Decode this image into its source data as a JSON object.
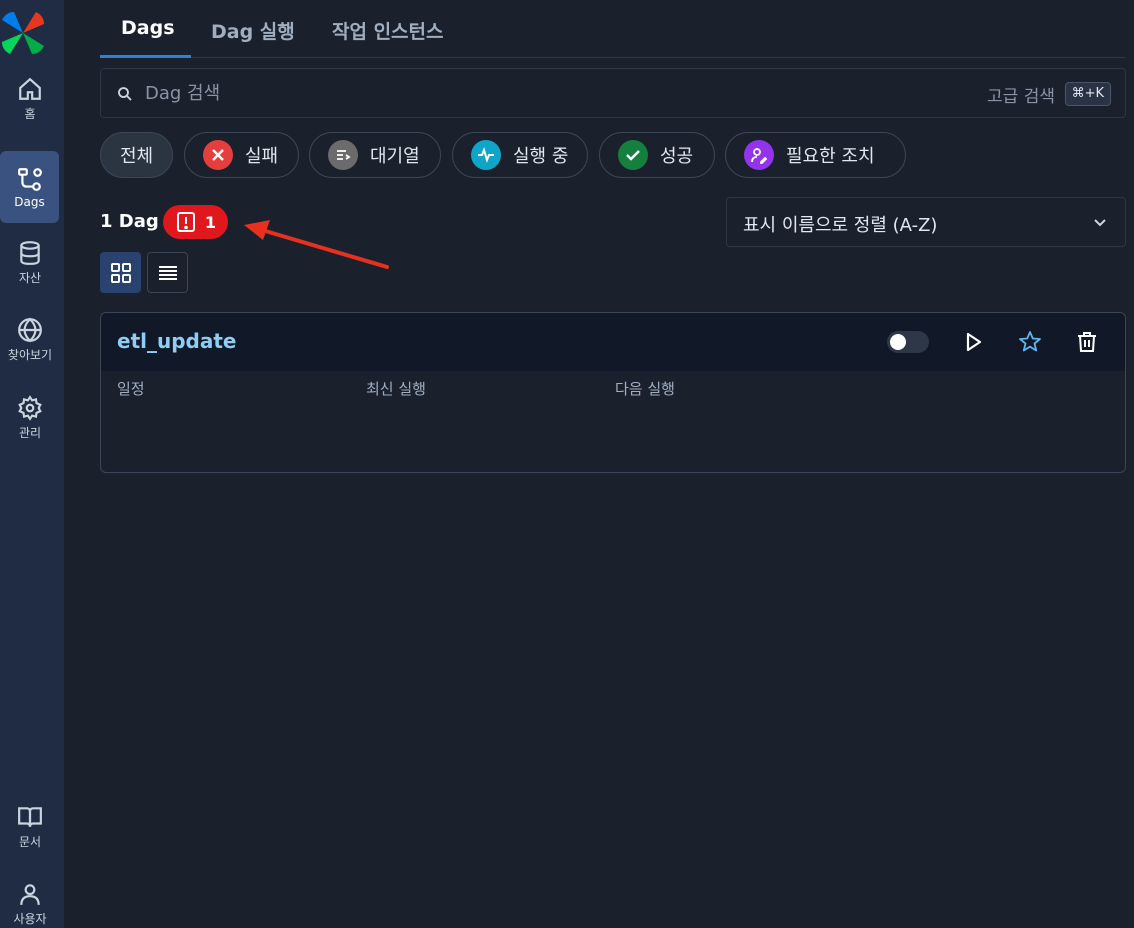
{
  "sidebar": {
    "items": [
      {
        "label": "홈",
        "icon": "home-icon"
      },
      {
        "label": "Dags",
        "icon": "dags-icon",
        "active": true
      },
      {
        "label": "자산",
        "icon": "database-icon"
      },
      {
        "label": "찾아보기",
        "icon": "globe-icon"
      },
      {
        "label": "관리",
        "icon": "gear-icon"
      },
      {
        "label": "문서",
        "icon": "book-icon"
      },
      {
        "label": "사용자",
        "icon": "user-icon"
      }
    ]
  },
  "tabs": [
    {
      "label": "Dags",
      "active": true
    },
    {
      "label": "Dag 실행"
    },
    {
      "label": "작업 인스턴스"
    }
  ],
  "search": {
    "placeholder": "Dag 검색",
    "advanced_label": "고급 검색",
    "shortcut": "⌘+K"
  },
  "filters": [
    {
      "label": "전체"
    },
    {
      "label": "실패",
      "color": "#e53e3e",
      "icon": "x-icon"
    },
    {
      "label": "대기열",
      "color": "#6b6b6b",
      "icon": "queue-icon"
    },
    {
      "label": "실행 중",
      "color": "#0ea5c9",
      "icon": "pulse-icon"
    },
    {
      "label": "성공",
      "color": "#15803d",
      "icon": "check-icon"
    },
    {
      "label": "필요한 조치",
      "color": "#9333ea",
      "icon": "user-edit-icon"
    }
  ],
  "summary": {
    "dag_count": "1 Dag",
    "error_count": "1"
  },
  "sort": {
    "selected": "표시 이름으로 정렬 (A-Z)"
  },
  "dags": [
    {
      "name": "etl_update",
      "paused": true,
      "labels": {
        "schedule": "일정",
        "latest_run": "최신 실행",
        "next_run": "다음 실행"
      }
    }
  ],
  "colors": {
    "accent": "#3182ce",
    "error": "#e0181e",
    "annotation_arrow": "#e8301e"
  }
}
